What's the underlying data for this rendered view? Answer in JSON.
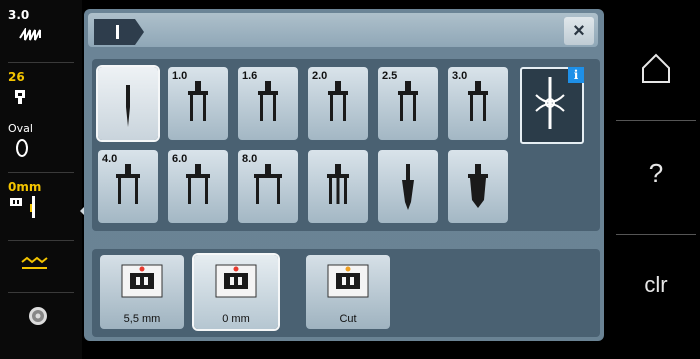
{
  "left_panel": {
    "stitch_width": "3.0",
    "stitch_length": "26",
    "hoop_label": "Oval",
    "needle_position": "0mm"
  },
  "dialog": {
    "close_label": "×",
    "needles": [
      {
        "label": "",
        "kind": "single",
        "selected": true
      },
      {
        "label": "1.0",
        "kind": "twin"
      },
      {
        "label": "1.6",
        "kind": "twin"
      },
      {
        "label": "2.0",
        "kind": "twin"
      },
      {
        "label": "2.5",
        "kind": "twin"
      },
      {
        "label": "3.0",
        "kind": "twin"
      },
      {
        "label": "4.0",
        "kind": "twin"
      },
      {
        "label": "6.0",
        "kind": "twin"
      },
      {
        "label": "8.0",
        "kind": "twin"
      },
      {
        "label": "",
        "kind": "triple"
      },
      {
        "label": "",
        "kind": "wing"
      },
      {
        "label": "",
        "kind": "special"
      }
    ],
    "info_badge": "i",
    "plates": [
      {
        "label": "5,5 mm",
        "dot_color": "#e83a2e",
        "selected": false
      },
      {
        "label": "0 mm",
        "dot_color": "#e83a2e",
        "selected": true
      },
      {
        "label": "Cut",
        "dot_color": "#f0a020",
        "selected": false
      }
    ]
  },
  "right_panel": {
    "home": "home-icon",
    "help": "?",
    "clear": "clr"
  }
}
